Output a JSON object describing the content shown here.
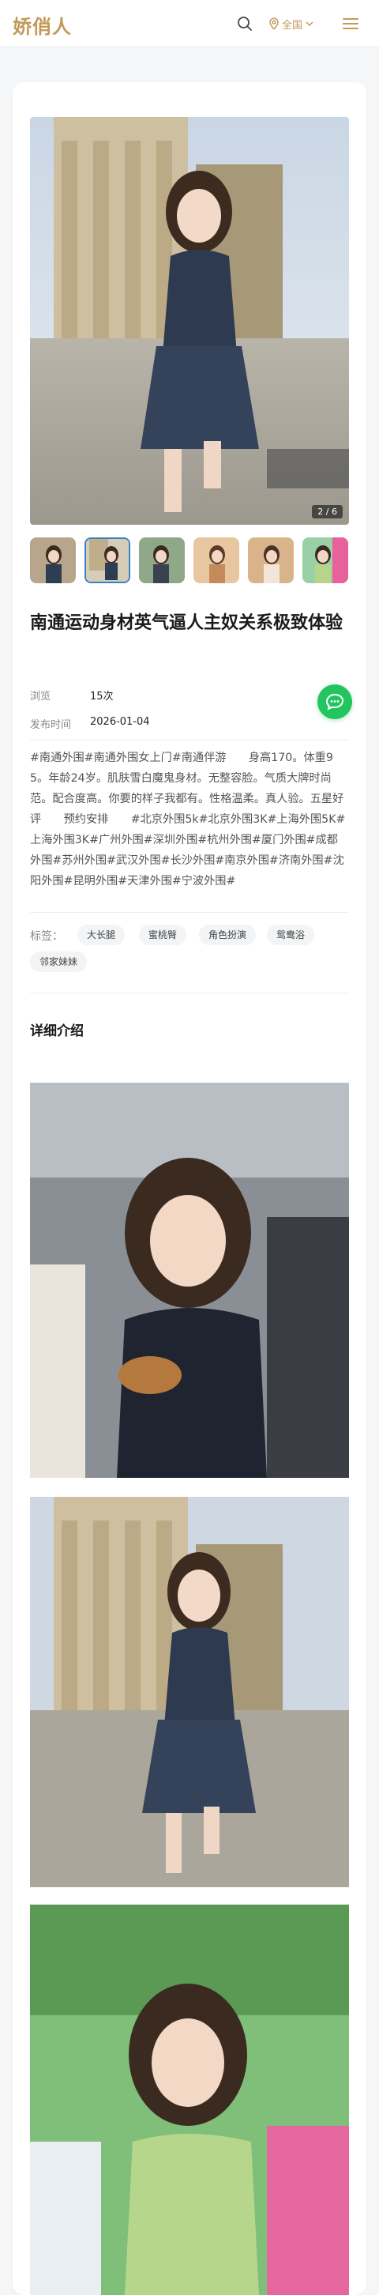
{
  "header": {
    "logo": "娇俏人",
    "location_label": "全国"
  },
  "gallery": {
    "counter": "2 / 6",
    "thumbnails": [
      "thumbnail-1",
      "thumbnail-2",
      "thumbnail-3",
      "thumbnail-4",
      "thumbnail-5",
      "thumbnail-6"
    ],
    "active_index": 2
  },
  "post": {
    "title": "南通运动身材英气逼人主奴关系极致体验",
    "views_label": "浏览",
    "views_value": "15次",
    "date_label": "发布时间",
    "date_value": "2026-01-04",
    "description": "#南通外围#南通外围女上门#南通伴游　　身高170。体重95。年龄24岁。肌肤雪白魔鬼身材。无整容脸。气质大牌时尚范。配合度高。你要的样子我都有。性格温柔。真人验。五星好评　　预约安排　　#北京外围5k#北京外围3K#上海外围5K#上海外围3K#广州外围#深圳外围#杭州外围#厦门外围#成都外围#苏州外围#武汉外围#长沙外围#南京外围#济南外围#沈阳外围#昆明外围#天津外围#宁波外围#",
    "tags_label": "标签：",
    "tags": [
      "大长腿",
      "蜜桃臀",
      "角色扮演",
      "鸳鸯浴",
      "邻家妹妹"
    ]
  },
  "details": {
    "section_title": "详细介绍"
  },
  "colors": {
    "accent": "#c29a58",
    "chat": "#22c55e",
    "active_thumb_border": "#3b82c4"
  },
  "icons": [
    "search-icon",
    "location-pin-icon",
    "chevron-down-icon",
    "menu-icon",
    "chat-icon"
  ]
}
